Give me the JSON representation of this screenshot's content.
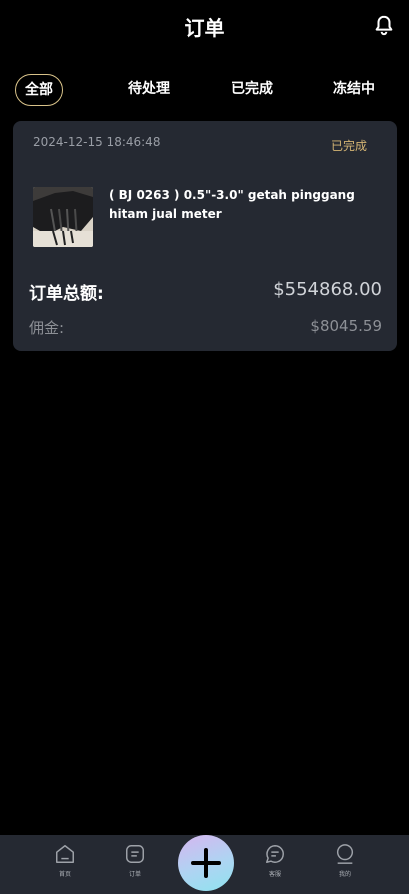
{
  "header": {
    "title": "订单"
  },
  "tabs": [
    {
      "label": "全部"
    },
    {
      "label": "待处理"
    },
    {
      "label": "已完成"
    },
    {
      "label": "冻结中"
    }
  ],
  "order": {
    "date": "2024-12-15 18:46:48",
    "status": "已完成",
    "product_name": "( BJ 0263 ) 0.5\"-3.0\" getah pinggang hitam jual meter",
    "total_label": "订单总额:",
    "total_value": "$554868.00",
    "commission_label": "佣金:",
    "commission_value": "$8045.59"
  },
  "bottom_nav": [
    {
      "label": "首页",
      "icon": "home-icon"
    },
    {
      "label": "订单",
      "icon": "orders-icon"
    },
    {
      "label": "",
      "icon": "plus-icon"
    },
    {
      "label": "客服",
      "icon": "chat-icon"
    },
    {
      "label": "我的",
      "icon": "profile-icon"
    }
  ],
  "colors": {
    "background": "#000000",
    "card": "#252932",
    "accent_gold": "#d5b574",
    "active_tab_border": "#d9c38a"
  }
}
